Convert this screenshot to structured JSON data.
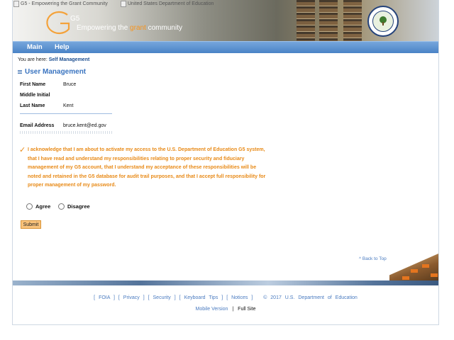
{
  "header": {
    "logo_alt": "G5 - Empowering the Grant Community",
    "dept_alt": "United States Department of Education",
    "logo_text": "G5",
    "tagline_pre": "Empowering the ",
    "tagline_hl": "grant",
    "tagline_post": " community"
  },
  "nav": {
    "main": "Main",
    "help": "Help"
  },
  "breadcrumb": {
    "prefix": "You are here:",
    "current": "Self Management"
  },
  "section_title": "User Management",
  "fields": {
    "first_name": {
      "label": "First Name",
      "value": "Bruce"
    },
    "middle_initial": {
      "label": "Middle Initial",
      "value": ""
    },
    "last_name": {
      "label": "Last Name",
      "value": "Kent"
    },
    "email": {
      "label": "Email Address",
      "value": "bruce.kent@ed.gov"
    }
  },
  "acknowledgement": {
    "line1": "I acknowledge that I am about to activate my access to the U.S. Department of Education G5 system,",
    "line2": "that I have read and understand my responsibilities relating to proper security and fiduciary",
    "line3": "management of my G5 account, that I understand my acceptance of these responsibilities will be",
    "line4": "noted and retained in the G5 database for audit trail purposes, and that I accept full responsibility for",
    "line5": "proper management of my password."
  },
  "options": {
    "agree": "Agree",
    "disagree": "Disagree"
  },
  "submit_label": "Submit",
  "back_to_top": "^ Back to Top",
  "footer": {
    "foia": "FOIA",
    "privacy": "Privacy",
    "security": "Security",
    "keyboard_tips": "Keyboard Tips",
    "notices": "Notices",
    "copyright": "© 2017 U.S. Department of Education",
    "mobile_version": "Mobile Version",
    "separator": "|",
    "full_site": "Full Site"
  },
  "colors": {
    "nav_blue": "#4a83c6",
    "accent_orange": "#e88a17",
    "link_blue": "#4a7bc0"
  }
}
